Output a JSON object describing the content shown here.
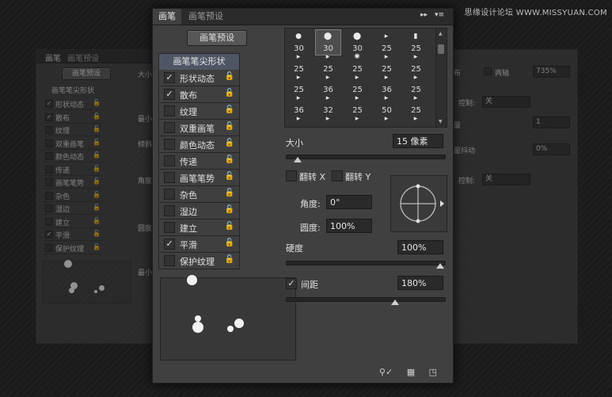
{
  "watermark": "思缘设计论坛 WWW.MISSYUAN.COM",
  "main": {
    "tabs": [
      {
        "label": "画笔"
      },
      {
        "label": "画笔预设"
      }
    ],
    "header_controls": {
      "collapse": "▸▸",
      "menu": "▾≡"
    },
    "preset_button": "画笔预设",
    "list_header": "画笔笔尖形状",
    "items": [
      {
        "label": "形状动态",
        "checked": "✓"
      },
      {
        "label": "散布",
        "checked": "✓"
      },
      {
        "label": "纹理",
        "checked": ""
      },
      {
        "label": "双重画笔",
        "checked": ""
      },
      {
        "label": "颜色动态",
        "checked": ""
      },
      {
        "label": "传递",
        "checked": ""
      },
      {
        "label": "画笔笔势",
        "checked": ""
      },
      {
        "label": "杂色",
        "checked": ""
      },
      {
        "label": "湿边",
        "checked": ""
      },
      {
        "label": "建立",
        "checked": ""
      },
      {
        "label": "平滑",
        "checked": "✓"
      },
      {
        "label": "保护纹理",
        "checked": ""
      }
    ],
    "lock_glyph": "🔓",
    "brushes": [
      {
        "icon": "●",
        "size": "30"
      },
      {
        "icon": "⬤",
        "size": "30"
      },
      {
        "icon": "⬤",
        "size": "30"
      },
      {
        "icon": "▸",
        "size": "25"
      },
      {
        "icon": "▮",
        "size": "25"
      },
      {
        "icon": "▸",
        "size": "25"
      },
      {
        "icon": "▸",
        "size": "25"
      },
      {
        "icon": "✺",
        "size": "25"
      },
      {
        "icon": "▸",
        "size": "25"
      },
      {
        "icon": "▸",
        "size": "25"
      },
      {
        "icon": "▸",
        "size": "25"
      },
      {
        "icon": "▸",
        "size": "36"
      },
      {
        "icon": "▸",
        "size": "25"
      },
      {
        "icon": "▸",
        "size": "36"
      },
      {
        "icon": "▸",
        "size": "25"
      },
      {
        "icon": "▸",
        "size": "36"
      },
      {
        "icon": "▸",
        "size": "32"
      },
      {
        "icon": "▸",
        "size": "25"
      },
      {
        "icon": "▸",
        "size": "50"
      },
      {
        "icon": "▸",
        "size": "25"
      },
      {
        "icon": "▸",
        "size": "25"
      },
      {
        "icon": "▸",
        "size": "50"
      },
      {
        "icon": "▸",
        "size": "71"
      },
      {
        "icon": "▸",
        "size": "25"
      },
      {
        "icon": "▸",
        "size": "50"
      }
    ],
    "size_label": "大小",
    "size_value": "15 像素",
    "size_level": 0.05,
    "flip_x_label": "翻转 X",
    "flip_y_label": "翻转 Y",
    "angle_label": "角度:",
    "angle_value": "0°",
    "roundness_label": "圆度:",
    "roundness_value": "100%",
    "hardness_label": "硬度",
    "hardness_value": "100%",
    "hardness_level": 1.0,
    "spacing_label": "间距",
    "spacing_value": "180%",
    "spacing_checked": "✓",
    "spacing_level": 0.7,
    "bottom_icons": [
      "brush-tool-icon",
      "grid-icon",
      "new-page-icon"
    ]
  },
  "bg_left": {
    "tabs": [
      "画笔",
      "画笔预设"
    ],
    "preset_button": "画笔预设",
    "header": "画笔笔尖形状",
    "items": [
      {
        "label": "形状动态",
        "checked": "✓"
      },
      {
        "label": "散布",
        "checked": "✓"
      },
      {
        "label": "纹理",
        "checked": ""
      },
      {
        "label": "双重画笔",
        "checked": ""
      },
      {
        "label": "颜色动态",
        "checked": ""
      },
      {
        "label": "传递",
        "checked": ""
      },
      {
        "label": "画笔笔势",
        "checked": ""
      },
      {
        "label": "杂色",
        "checked": ""
      },
      {
        "label": "湿边",
        "checked": ""
      },
      {
        "label": "建立",
        "checked": ""
      },
      {
        "label": "平滑",
        "checked": "✓"
      },
      {
        "label": "保护纹理",
        "checked": ""
      }
    ]
  },
  "bg_right": {
    "both_axes": "两轴",
    "scatter_value": "735%",
    "control_label_1": "控制:",
    "control_value_1": "关",
    "count_value": "1",
    "count_jitter": "量抖动",
    "count_jitter_value": "0%",
    "control_label_2": "控制:",
    "control_value_2": "关",
    "frag_bu": "布",
    "frag_liang": "量"
  }
}
